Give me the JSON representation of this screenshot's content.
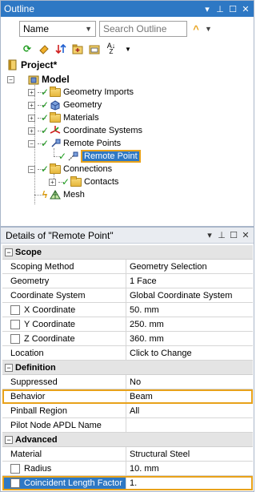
{
  "outline": {
    "title": "Outline",
    "name_select": "Name",
    "search_placeholder": "Search Outline",
    "tree": {
      "project": "Project*",
      "model": "Model",
      "items": [
        "Geometry Imports",
        "Geometry",
        "Materials",
        "Coordinate Systems",
        "Remote Points",
        "Remote Point",
        "Connections",
        "Contacts",
        "Mesh"
      ]
    }
  },
  "details": {
    "title": "Details of \"Remote Point\"",
    "sections": {
      "scope": "Scope",
      "definition": "Definition",
      "advanced": "Advanced"
    },
    "rows": {
      "scoping_method": {
        "label": "Scoping Method",
        "value": "Geometry Selection"
      },
      "geometry": {
        "label": "Geometry",
        "value": "1 Face"
      },
      "coordinate_system": {
        "label": "Coordinate System",
        "value": "Global Coordinate System"
      },
      "x_coordinate": {
        "label": "X Coordinate",
        "value": "50. mm"
      },
      "y_coordinate": {
        "label": "Y Coordinate",
        "value": "250. mm"
      },
      "z_coordinate": {
        "label": "Z Coordinate",
        "value": "360. mm"
      },
      "location": {
        "label": "Location",
        "value": "Click to Change"
      },
      "suppressed": {
        "label": "Suppressed",
        "value": "No"
      },
      "behavior": {
        "label": "Behavior",
        "value": "Beam"
      },
      "pinball_region": {
        "label": "Pinball Region",
        "value": "All"
      },
      "pilot_node": {
        "label": "Pilot Node APDL Name",
        "value": ""
      },
      "material": {
        "label": "Material",
        "value": "Structural Steel"
      },
      "radius": {
        "label": "Radius",
        "value": "10. mm"
      },
      "coincident_length_factor": {
        "label": "Coincident Length Factor",
        "value": "1."
      }
    }
  },
  "colors": {
    "titlebar": "#2e78c4",
    "highlight": "#e8a21a",
    "check": "#1a9a1a"
  }
}
